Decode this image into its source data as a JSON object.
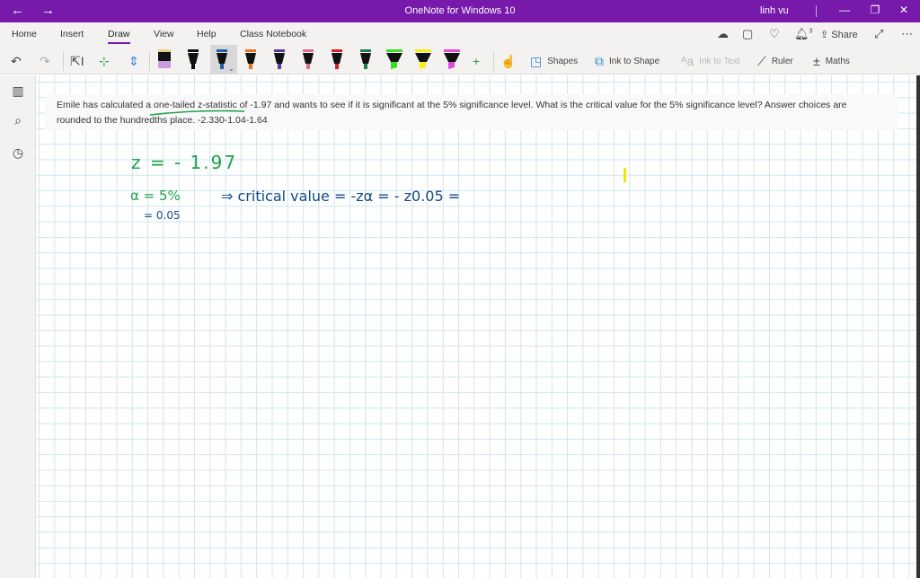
{
  "window": {
    "title": "OneNote for Windows 10",
    "user": "linh vu",
    "back_icon": "←",
    "forward_icon": "→",
    "minimize_icon": "—",
    "restore_icon": "❐",
    "close_icon": "✕"
  },
  "ribbon": {
    "tabs": [
      {
        "label": "Home"
      },
      {
        "label": "Insert"
      },
      {
        "label": "Draw",
        "active": true
      },
      {
        "label": "View"
      },
      {
        "label": "Help"
      },
      {
        "label": "Class Notebook"
      }
    ],
    "right_actions": {
      "share_label": "Share",
      "notification_count": "3"
    },
    "tools": {
      "shapes_label": "Shapes",
      "ink_to_shape_label": "Ink to Shape",
      "ink_to_text_label": "Ink to Text",
      "ruler_label": "Ruler",
      "maths_label": "Maths"
    },
    "pens": [
      {
        "name": "eraser",
        "color": "#c99be0",
        "type": "eraser"
      },
      {
        "name": "black-pen",
        "color": "#111111",
        "type": "pen"
      },
      {
        "name": "blue-pen",
        "color": "#1f5fa8",
        "type": "pen",
        "selected": true
      },
      {
        "name": "orange-pen",
        "color": "#e8731d",
        "type": "pen"
      },
      {
        "name": "purple-pen",
        "color": "#5b3aa0",
        "type": "pen"
      },
      {
        "name": "pink-pen",
        "color": "#e06c8f",
        "type": "pen"
      },
      {
        "name": "red-pen",
        "color": "#d42028",
        "type": "pen"
      },
      {
        "name": "green-pen",
        "color": "#1e7a48",
        "type": "pen"
      },
      {
        "name": "green-highlighter",
        "color": "#38e021",
        "type": "highlighter"
      },
      {
        "name": "yellow-highlighter",
        "color": "#f5ee1a",
        "type": "highlighter"
      },
      {
        "name": "magenta-highlighter",
        "color": "#e24be0",
        "type": "highlighter"
      }
    ]
  },
  "page": {
    "question_line1": "Emile has calculated a one-tailed z-statistic of -1.97 and wants to see if it is significant at the 5% significance level. What is the critical value for the 5% significance level? Answer choices are",
    "question_line2": "rounded to the hundredths place. -2.330-1.04-1.64",
    "ink": {
      "line1": "z = - 1.97",
      "line2_alpha": "α = 5%",
      "line2_rest": "⇒ critical value = -zα = - z0.05 =",
      "line3": "= 0.05",
      "green": "#1ea14b",
      "blue": "#114a8c",
      "yellow_mark": "#f0e800"
    }
  }
}
